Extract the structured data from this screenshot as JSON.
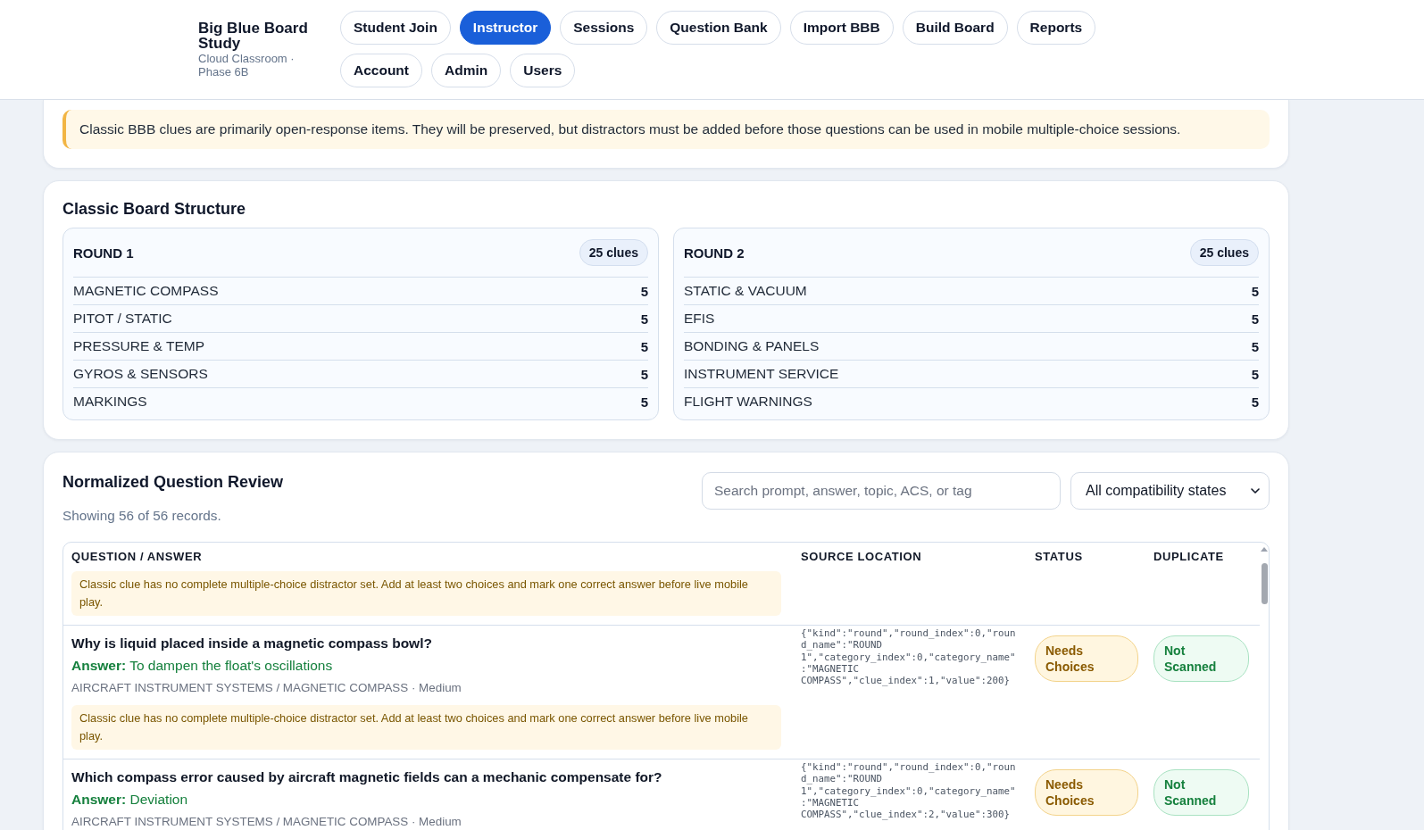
{
  "header": {
    "brand": {
      "title": "Big Blue Board Study",
      "subtitle": "Cloud Classroom · Phase 6B"
    },
    "nav": [
      {
        "label": "Student Join",
        "selected": false
      },
      {
        "label": "Instructor",
        "selected": true
      },
      {
        "label": "Sessions",
        "selected": false
      },
      {
        "label": "Question Bank",
        "selected": false
      },
      {
        "label": "Import BBB",
        "selected": false
      },
      {
        "label": "Build Board",
        "selected": false
      },
      {
        "label": "Reports",
        "selected": false
      },
      {
        "label": "Account",
        "selected": false
      },
      {
        "label": "Admin",
        "selected": false
      },
      {
        "label": "Users",
        "selected": false
      }
    ]
  },
  "import_panel": {
    "notice": "Classic BBB clues are primarily open-response items. They will be preserved, but distractors must be added before those questions can be used in mobile multiple-choice sessions."
  },
  "board_structure": {
    "title": "Classic Board Structure",
    "rounds": [
      {
        "name": "ROUND 1",
        "count": "25 clues",
        "categories": [
          {
            "name": "MAGNETIC COMPASS",
            "count": "5"
          },
          {
            "name": "PITOT / STATIC",
            "count": "5"
          },
          {
            "name": "PRESSURE & TEMP",
            "count": "5"
          },
          {
            "name": "GYROS & SENSORS",
            "count": "5"
          },
          {
            "name": "MARKINGS",
            "count": "5"
          }
        ]
      },
      {
        "name": "ROUND 2",
        "count": "25 clues",
        "categories": [
          {
            "name": "STATIC & VACUUM",
            "count": "5"
          },
          {
            "name": "EFIS",
            "count": "5"
          },
          {
            "name": "BONDING & PANELS",
            "count": "5"
          },
          {
            "name": "INSTRUMENT SERVICE",
            "count": "5"
          },
          {
            "name": "FLIGHT WARNINGS",
            "count": "5"
          }
        ]
      }
    ]
  },
  "question_review": {
    "title": "Normalized Question Review",
    "summary": "Showing 56 of 56 records.",
    "search": {
      "placeholder": "Search prompt, answer, topic, ACS, or tag"
    },
    "filter": {
      "value": "All compatibility states"
    },
    "table": {
      "columns": [
        "QUESTION / ANSWER",
        "SOURCE LOCATION",
        "STATUS",
        "DUPLICATE"
      ],
      "rows": [
        {
          "note": "Classic clue has no complete multiple-choice distractor set. Add at least two choices and mark one correct answer before live mobile play."
        },
        {
          "question": "Why is liquid placed inside a magnetic compass bowl?",
          "answer": "**Answer:** To dampen the float's oscillations",
          "topic": "AIRCRAFT INSTRUMENT SYSTEMS / MAGNETIC COMPASS · Medium",
          "note": "Classic clue has no complete multiple-choice distractor set. Add at least two choices and mark one correct answer before live mobile play.",
          "source": "{\"kind\":\"round\",\"round_index\":0,\"round_name\":\"ROUND 1\",\"category_index\":0,\"category_name\":\"MAGNETIC COMPASS\",\"clue_index\":1,\"value\":200}",
          "status": {
            "label": "Needs Choices",
            "kind": "warning"
          },
          "duplicate": {
            "label": "Not Scanned",
            "kind": "success"
          }
        },
        {
          "question": "Which compass error caused by aircraft magnetic fields can a mechanic compensate for?",
          "answer": "**Answer:** Deviation",
          "topic": "AIRCRAFT INSTRUMENT SYSTEMS / MAGNETIC COMPASS · Medium",
          "source": "{\"kind\":\"round\",\"round_index\":0,\"round_name\":\"ROUND 1\",\"category_index\":0,\"category_name\":\"MAGNETIC COMPASS\",\"clue_index\":2,\"value\":300}",
          "status": {
            "label": "Needs Choices",
            "kind": "warning"
          },
          "duplicate": {
            "label": "Not Scanned",
            "kind": "success"
          }
        }
      ]
    }
  }
}
